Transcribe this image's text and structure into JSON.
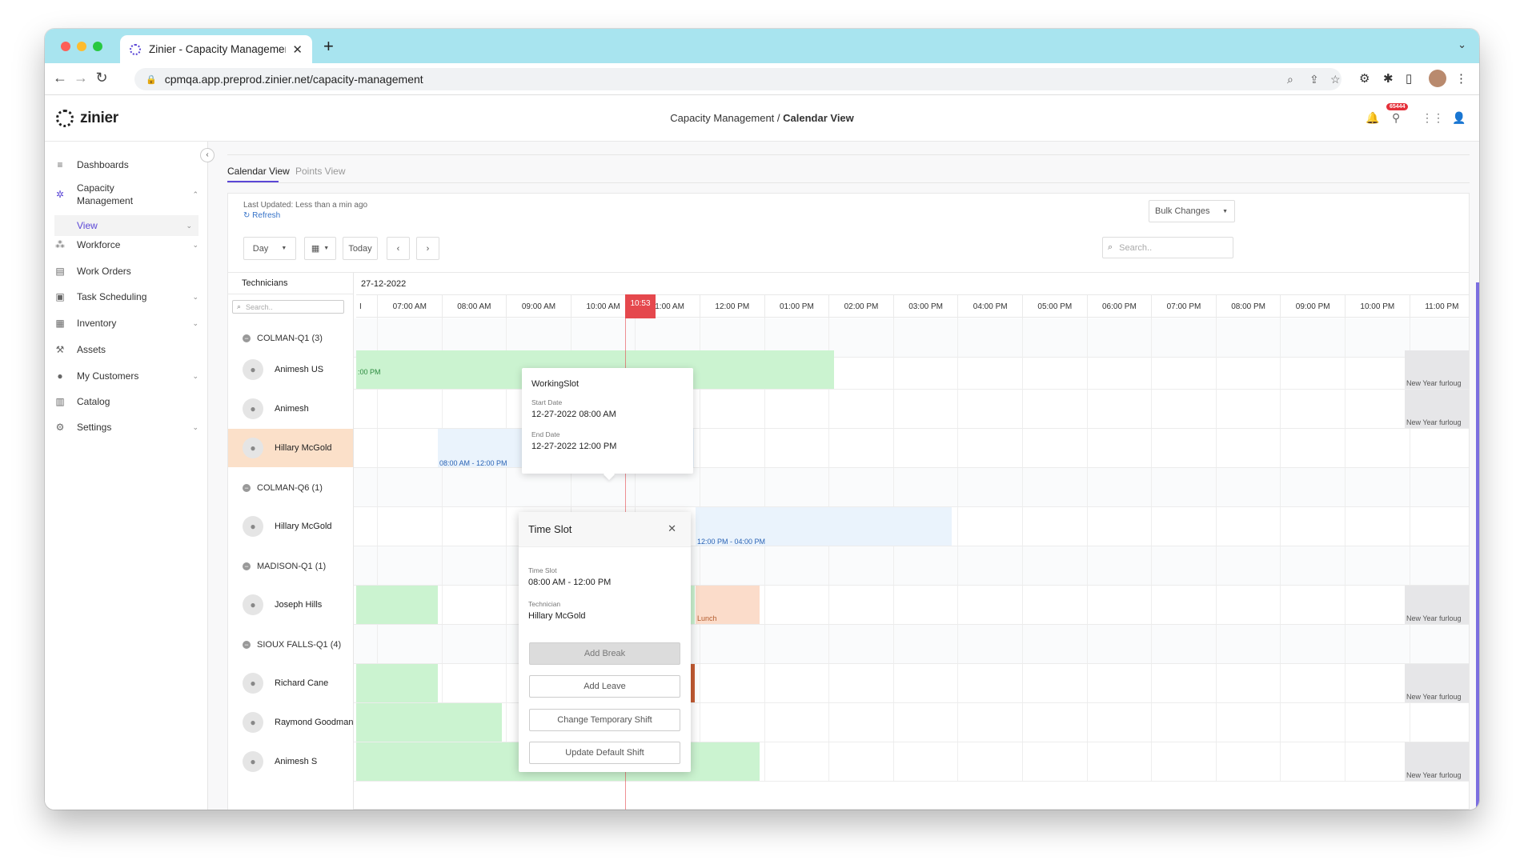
{
  "browser": {
    "tab_title": "Zinier - Capacity Management",
    "url": "cpmqa.app.preprod.zinier.net/capacity-management"
  },
  "app": {
    "logo_text": "zinier",
    "breadcrumb_parent": "Capacity Management /",
    "breadcrumb_current": "Calendar View",
    "notification_badge": "65444"
  },
  "sidebar": {
    "items": [
      {
        "label": "Dashboards",
        "icon": "layers-icon",
        "chevron": false
      },
      {
        "label": "Capacity\nManagement",
        "icon": "people-icon",
        "chevron": true
      },
      {
        "label": "Workforce",
        "icon": "group-icon",
        "chevron": true
      },
      {
        "label": "Work Orders",
        "icon": "clipboard-icon",
        "chevron": false
      },
      {
        "label": "Task Scheduling",
        "icon": "truck-icon",
        "chevron": true
      },
      {
        "label": "Inventory",
        "icon": "box-icon",
        "chevron": true
      },
      {
        "label": "Assets",
        "icon": "assets-icon",
        "chevron": false
      },
      {
        "label": "My Customers",
        "icon": "customer-icon",
        "chevron": true
      },
      {
        "label": "Catalog",
        "icon": "book-icon",
        "chevron": false
      },
      {
        "label": "Settings",
        "icon": "gear-icon",
        "chevron": true
      }
    ],
    "sub_item": "View"
  },
  "tabs": {
    "calendar": "Calendar View",
    "points": "Points View"
  },
  "toolbar": {
    "last_updated": "Last Updated: Less than a min ago",
    "refresh": "Refresh",
    "bulk_changes": "Bulk Changes",
    "view_mode": "Day",
    "today": "Today",
    "search_placeholder": "Search.."
  },
  "calendar": {
    "technicians_header": "Technicians",
    "tech_search_placeholder": "Search..",
    "date": "27-12-2022",
    "now_time": "10:53",
    "first_hour_fragment": "I",
    "hours": [
      "07:00 AM",
      "08:00 AM",
      "09:00 AM",
      "10:00 AM",
      "11:00 AM",
      "12:00 PM",
      "01:00 PM",
      "02:00 PM",
      "03:00 PM",
      "04:00 PM",
      "05:00 PM",
      "06:00 PM",
      "07:00 PM",
      "08:00 PM",
      "09:00 PM",
      "10:00 PM",
      "11:00 PM"
    ],
    "rows": [
      {
        "type": "group",
        "label": "COLMAN-Q1 (3)"
      },
      {
        "type": "tech",
        "name": "Animesh US",
        "label": ":00 PM",
        "furlough": "New Year furloug"
      },
      {
        "type": "tech",
        "name": "Animesh",
        "furlough": "New Year furloug"
      },
      {
        "type": "tech",
        "name": "Hillary McGold",
        "label": "08:00 AM - 12:00 PM"
      },
      {
        "type": "group",
        "label": "COLMAN-Q6 (1)"
      },
      {
        "type": "tech",
        "name": "Hillary McGold",
        "label": "12:00 PM - 04:00 PM"
      },
      {
        "type": "group",
        "label": "MADISON-Q1 (1)"
      },
      {
        "type": "tech",
        "name": "Joseph Hills",
        "label": "Lunch",
        "furlough": "New Year furloug"
      },
      {
        "type": "group",
        "label": "SIOUX FALLS-Q1 (4)"
      },
      {
        "type": "tech",
        "name": "Richard Cane",
        "furlough": "New Year furloug"
      },
      {
        "type": "tech",
        "name": "Raymond Goodman"
      },
      {
        "type": "tech",
        "name": "Animesh S",
        "furlough": "New Year furloug"
      }
    ]
  },
  "tooltip": {
    "title": "WorkingSlot",
    "start_label": "Start Date",
    "start_value": "12-27-2022 08:00 AM",
    "end_label": "End Date",
    "end_value": "12-27-2022 12:00 PM"
  },
  "modal": {
    "title": "Time Slot",
    "slot_label": "Time Slot",
    "slot_value": "08:00 AM - 12:00 PM",
    "tech_label": "Technician",
    "tech_value": "Hillary McGold",
    "buttons": [
      "Add Break",
      "Add Leave",
      "Change Temporary Shift",
      "Update Default Shift"
    ]
  },
  "colors": {
    "accent": "#5b47d6",
    "working": "#cbf3d0",
    "slot": "#eaf3fc",
    "break": "#fbdcca",
    "leave": "#c65d33",
    "now": "#e5484d"
  }
}
